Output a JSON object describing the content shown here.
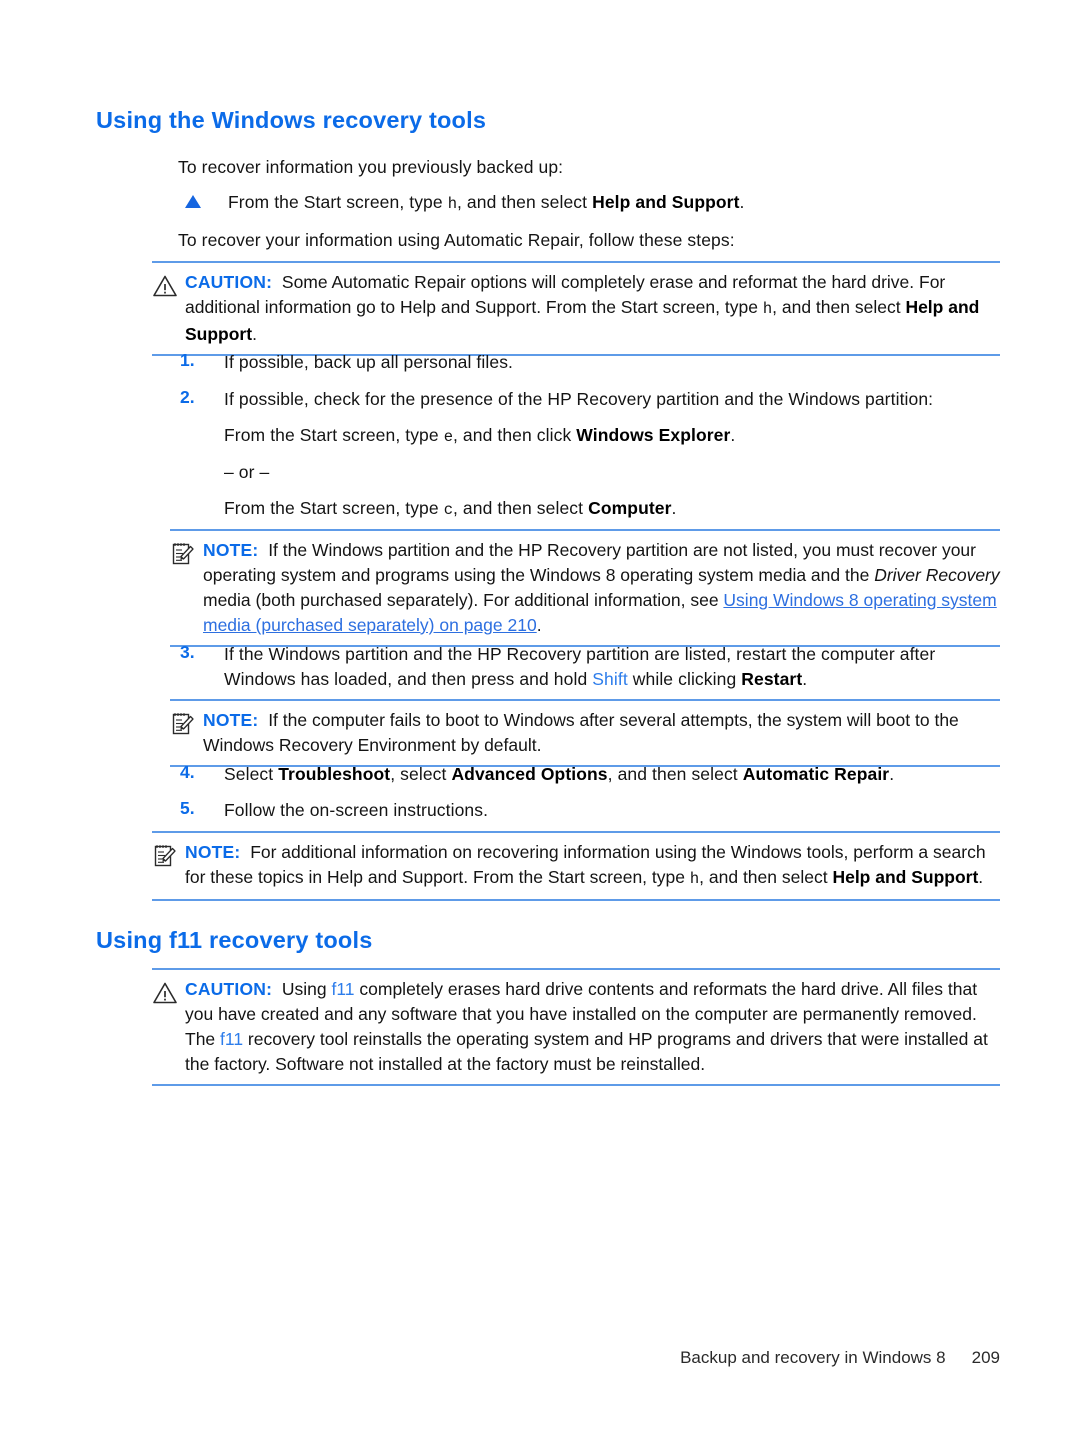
{
  "document": {
    "page_number": "209",
    "footer_text": "Backup and recovery in Windows 8"
  },
  "section1": {
    "heading": "Using the Windows recovery tools",
    "intro1": "To recover information you previously backed up:",
    "bullet1": {
      "pre": "From the Start screen, type ",
      "key": "h",
      "mid": ", and then select ",
      "bold": "Help and Support",
      "post": "."
    },
    "intro2": "To recover your information using Automatic Repair, follow these steps:",
    "caution1": {
      "label": "CAUTION:",
      "icon": "warning-triangle-icon",
      "t1": "Some Automatic Repair options will completely erase and reformat the hard drive. For additional information go to Help and Support. From the Start screen, type ",
      "key": "h",
      "t2": ", and then select ",
      "bold1": "Help and Support",
      "t3": "."
    },
    "steps": {
      "n1": "1.",
      "s1": "If possible, back up all personal files.",
      "n2": "2.",
      "s2": "If possible, check for the presence of the HP Recovery partition and the Windows partition:",
      "s2a_pre": "From the Start screen, type ",
      "s2a_key": "e",
      "s2a_mid": ", and then click ",
      "s2a_bold": "Windows Explorer",
      "s2a_post": ".",
      "or": "– or –",
      "s2b_pre": "From the Start screen, type ",
      "s2b_key": "c",
      "s2b_mid": ", and then select ",
      "s2b_bold": "Computer",
      "s2b_post": ".",
      "n3": "3.",
      "s3_pre": "If the Windows partition and the HP Recovery partition are listed, restart the computer after Windows has loaded, and then press and hold ",
      "s3_key": "Shift",
      "s3_mid": " while clicking ",
      "s3_bold": "Restart",
      "s3_post": ".",
      "n4": "4.",
      "s4_pre": "Select ",
      "s4_b1": "Troubleshoot",
      "s4_m1": ", select ",
      "s4_b2": "Advanced Options",
      "s4_m2": ", and then select ",
      "s4_b3": "Automatic Repair",
      "s4_post": ".",
      "n5": "5.",
      "s5": "Follow the on-screen instructions."
    },
    "note1": {
      "label": "NOTE:",
      "icon": "notepad-pencil-icon",
      "t1": "If the Windows partition and the HP Recovery partition are not listed, you must recover your operating system and programs using the Windows 8 operating system media and the ",
      "ital1": "Driver Recovery",
      "t2": " media (both purchased separately). For additional information, see ",
      "link": "Using Windows 8 operating system media (purchased separately) on page 210",
      "t3": "."
    },
    "note2": {
      "label": "NOTE:",
      "icon": "notepad-pencil-icon",
      "t1": "If the computer fails to boot to Windows after several attempts, the system will boot to the Windows Recovery Environment by default."
    },
    "note3": {
      "label": "NOTE:",
      "icon": "notepad-pencil-icon",
      "t1": "For additional information on recovering information using the Windows tools, perform a search for these topics in Help and Support. From the Start screen, type ",
      "key": "h",
      "t2": ", and then select ",
      "bold1": "Help and Support",
      "t3": "."
    }
  },
  "section2": {
    "heading_pre": "Using ",
    "heading_key": "f11",
    "heading_post": " recovery tools",
    "heading_full": "Using f11 recovery tools",
    "caution2": {
      "label": "CAUTION:",
      "icon": "warning-triangle-icon",
      "t1": "Using ",
      "key1": "f11",
      "t2": " completely erases hard drive contents and reformats the hard drive. All files that you have created and any software that you have installed on the computer are permanently removed. The ",
      "key2": "f11",
      "t3": " recovery tool reinstalls the operating system and HP programs and drivers that were installed at the factory. Software not installed at the factory must be reinstalled."
    }
  },
  "colors": {
    "heading_blue": "#0B6BE8",
    "rule_blue": "#5E9BE8",
    "link_blue": "#2D6FE0",
    "key_blue": "#2D7DEB"
  }
}
